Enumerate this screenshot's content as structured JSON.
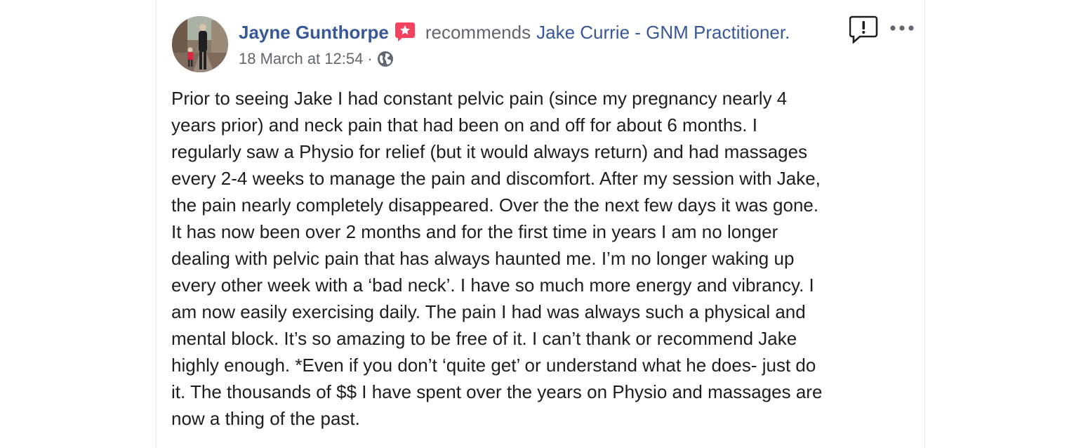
{
  "post": {
    "author": "Jayne Gunthorpe",
    "verb": "recommends",
    "page_name": "Jake Currie - GNM Practitioner.",
    "timestamp": "18 March at 12:54",
    "separator": "·",
    "privacy_icon": "globe-icon",
    "badge_icon": "recommendation-star-icon",
    "report_icon": "report-speech-bubble-icon",
    "more_icon": "more-options-ellipsis-icon",
    "avatar": "profile-photo",
    "body_lines": [
      "Prior to seeing Jake I had constant pelvic pain (since my pregnancy nearly 4",
      "years prior) and neck pain that had been on and off for about 6 months. I",
      "regularly saw a Physio for relief (but it would always return) and had massages",
      "every 2-4 weeks to manage the pain and discomfort. After my session with Jake,",
      "the pain nearly completely disappeared. Over the the next few days it was gone.",
      "It has now been over 2 months and for the first time in years I am no longer",
      "dealing with pelvic pain that has always haunted me. I’m no longer waking up",
      "every other week with a ‘bad neck’. I have so much more energy and vibrancy. I",
      "am now easily exercising daily. The pain I had was always such a physical and",
      "mental block. It’s so amazing to be free of it. I can’t thank or recommend Jake",
      "highly enough. *Even if you don’t ‘quite get’ or understand what he does- just do",
      "it. The thousands of $$ I have spent over the years on Physio and massages are",
      "now a thing of the past."
    ]
  },
  "colors": {
    "link": "#385898",
    "secondary_text": "#606770",
    "body_text": "#1c1e21",
    "badge": "#f3425f"
  }
}
